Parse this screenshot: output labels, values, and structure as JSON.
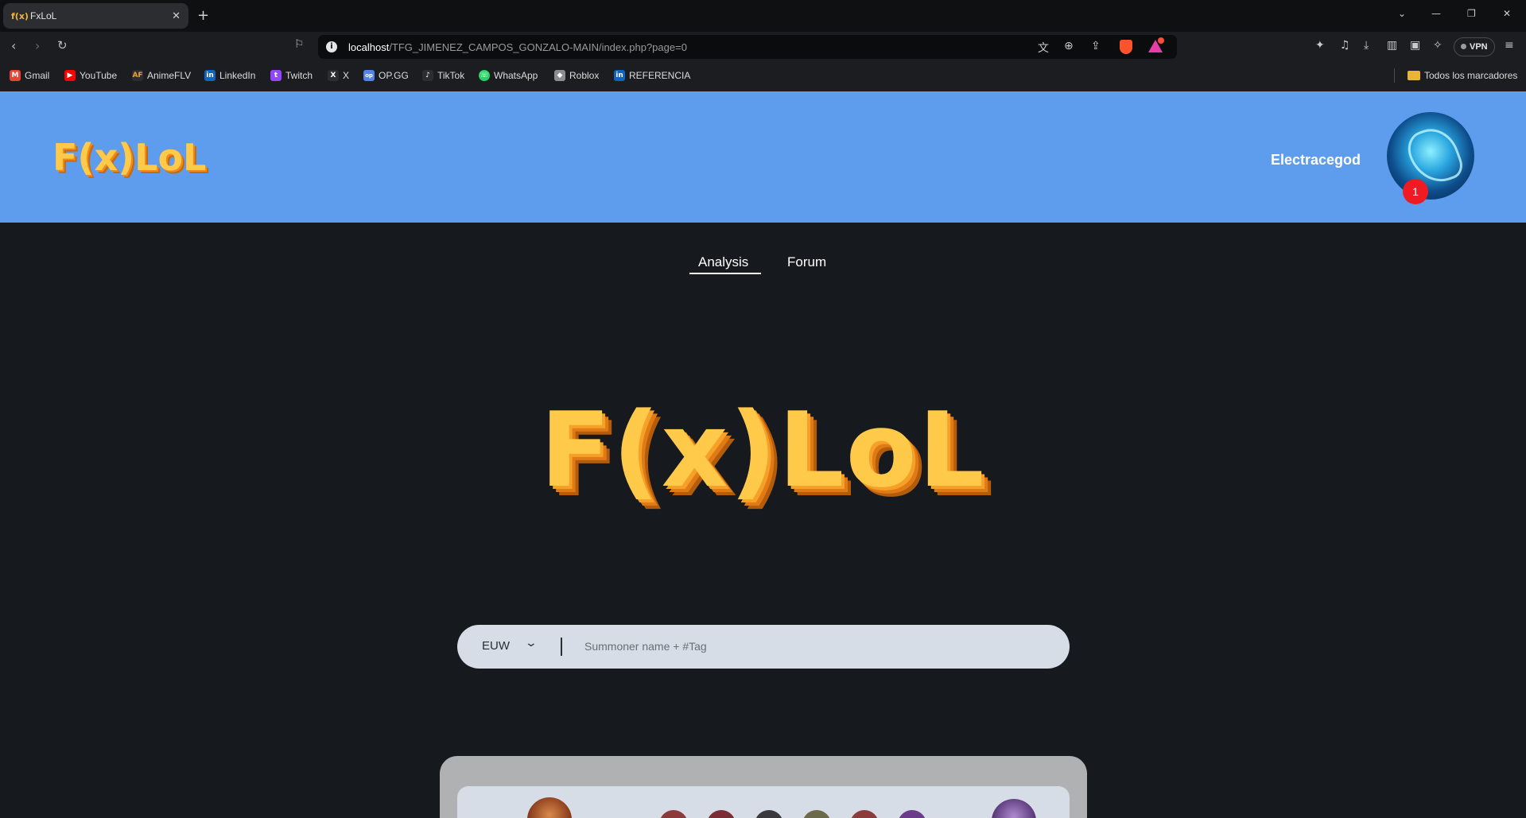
{
  "browser": {
    "tab": {
      "favicon": "f(x)",
      "title": "FxLoL"
    },
    "url": {
      "host": "localhost",
      "path": "/TFG_JIMENEZ_CAMPOS_GONZALO-MAIN/index.php?page=0"
    },
    "vpn_label": "VPN",
    "bookmarks": [
      {
        "label": "Gmail",
        "icon": "gmail-icon",
        "color": "#ea4335",
        "glyph": "M"
      },
      {
        "label": "YouTube",
        "icon": "youtube-icon",
        "color": "#ff0000",
        "glyph": "▶"
      },
      {
        "label": "AnimeFLV",
        "icon": "animeflv-icon",
        "color": "#2b2d31",
        "glyph": "AF"
      },
      {
        "label": "LinkedIn",
        "icon": "linkedin-icon",
        "color": "#0a66c2",
        "glyph": "in"
      },
      {
        "label": "Twitch",
        "icon": "twitch-icon",
        "color": "#9146ff",
        "glyph": "t"
      },
      {
        "label": "X",
        "icon": "x-icon",
        "color": "#2b2d31",
        "glyph": "X"
      },
      {
        "label": "OP.GG",
        "icon": "opgg-icon",
        "color": "#5383e8",
        "glyph": "op"
      },
      {
        "label": "TikTok",
        "icon": "tiktok-icon",
        "color": "#2b2d31",
        "glyph": "♪"
      },
      {
        "label": "WhatsApp",
        "icon": "whatsapp-icon",
        "color": "#25d366",
        "glyph": "☏"
      },
      {
        "label": "Roblox",
        "icon": "roblox-icon",
        "color": "#8a8d93",
        "glyph": "◆"
      },
      {
        "label": "REFERENCIA",
        "icon": "linkedin-icon",
        "color": "#0a66c2",
        "glyph": "in"
      }
    ],
    "bookmarks_folder": "Todos los marcadores"
  },
  "site": {
    "logo_text": "F(x)LoL",
    "username": "Electracegod",
    "notification_count": "1",
    "nav": {
      "analysis": "Analysis",
      "forum": "Forum"
    },
    "search": {
      "region": "EUW",
      "placeholder": "Summoner name + #Tag"
    }
  },
  "colors": {
    "header_bg": "#5e9ced",
    "page_bg": "#16191d",
    "logo": "#ffc94a",
    "notif": "#ef1b23"
  }
}
